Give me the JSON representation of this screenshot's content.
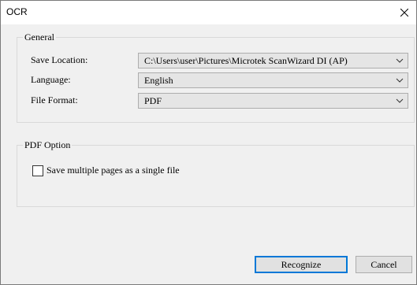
{
  "window": {
    "title": "OCR"
  },
  "general": {
    "legend": "General",
    "save_location": {
      "label": "Save Location:",
      "value": "C:\\Users\\user\\Pictures\\Microtek ScanWizard DI (AP)"
    },
    "language": {
      "label": "Language:",
      "value": "English"
    },
    "file_format": {
      "label": "File Format:",
      "value": "PDF"
    }
  },
  "pdf_option": {
    "legend": "PDF Option",
    "save_multiple": {
      "label": "Save multiple pages as a single file",
      "checked": false
    }
  },
  "buttons": {
    "recognize": "Recognize",
    "cancel": "Cancel"
  },
  "icons": {
    "close": "close-icon",
    "dropdown": "chevron-down-icon"
  }
}
